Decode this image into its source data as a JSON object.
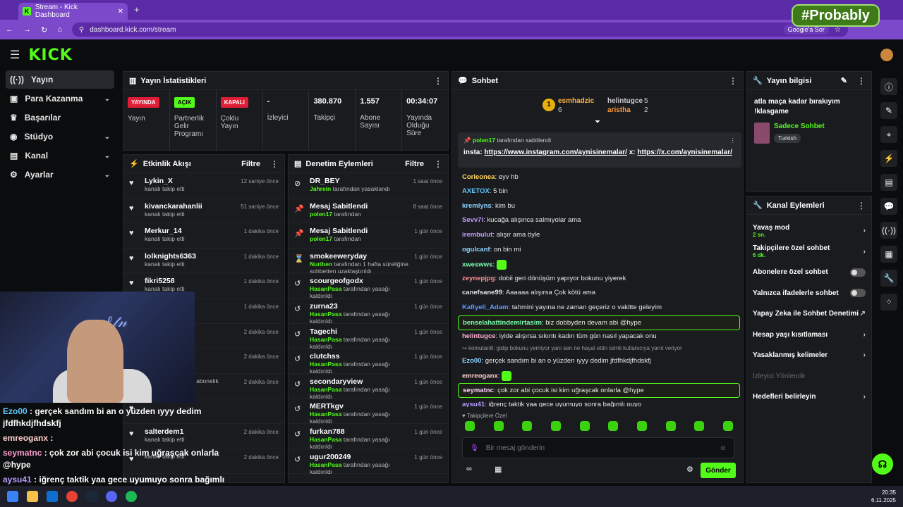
{
  "browser": {
    "tab_title": "Stream - Kick Dashboard",
    "url": "dashboard.kick.com/stream",
    "google_btn": "Google'a Sor",
    "overlay_badge": "#Probably"
  },
  "header": {
    "logo": "KICK"
  },
  "sidebar": {
    "items": [
      {
        "label": "Yayın",
        "icon": "stream-icon",
        "active": true
      },
      {
        "label": "Para Kazanma",
        "icon": "money-icon",
        "chevron": "⌄"
      },
      {
        "label": "Başarılar",
        "icon": "trophy-icon"
      },
      {
        "label": "Stüdyo",
        "icon": "studio-icon",
        "chevron": "⌄"
      },
      {
        "label": "Kanal",
        "icon": "channel-icon",
        "chevron": "⌄"
      },
      {
        "label": "Ayarlar",
        "icon": "settings-icon",
        "chevron": "⌄"
      }
    ]
  },
  "stats": {
    "title": "Yayın İstatistikleri",
    "cols": [
      {
        "badge": "YAYINDA",
        "badge_color": "#e01e37",
        "label": "Yayın"
      },
      {
        "badge": "AÇIK",
        "badge_color": "#53fc18",
        "label": "Partnerlik Gelir Programı"
      },
      {
        "badge": "KAPALI",
        "badge_color": "#e01e37",
        "label": "Çoklu Yayın"
      },
      {
        "value": "-",
        "label": "İzleyici"
      },
      {
        "value": "380.870",
        "label": "Takipçi"
      },
      {
        "value": "1.557",
        "label": "Abone Sayısı"
      },
      {
        "value": "00:34:07",
        "label": "Yayında Olduğu Süre"
      }
    ]
  },
  "events": {
    "title": "Etkinlik Akışı",
    "filter": "Filtre",
    "items": [
      {
        "name": "Lykin_X",
        "sub": "kanalı takip etti",
        "time": "12 saniye önce"
      },
      {
        "name": "kivanckarahanlii",
        "sub": "kanalı takip etti",
        "time": "51 saniye önce"
      },
      {
        "name": "Merkur_14",
        "sub": "kanalı takip etti",
        "time": "1 dakika önce"
      },
      {
        "name": "lolknights6363",
        "sub": "kanalı takip etti",
        "time": "1 dakika önce"
      },
      {
        "name": "fikri5258",
        "sub": "kanalı takip etti",
        "time": "1 dakika önce"
      },
      {
        "name": "",
        "sub": "",
        "time": "1 dakika önce"
      },
      {
        "name": "",
        "sub": "",
        "time": "2 dakika önce"
      },
      {
        "name": "",
        "sub": "",
        "time": "2 dakika önce"
      },
      {
        "name": "",
        "sub": "ni kutluyor! Toplam abonelik",
        "time": "2 dakika önce"
      },
      {
        "name": "",
        "sub": "",
        "time": ""
      },
      {
        "name": "salterdem1",
        "sub": "kanalı takip etti",
        "time": "2 dakika önce"
      },
      {
        "name": "",
        "sub": "kanalı takip etti",
        "time": "2 dakika önce"
      }
    ]
  },
  "mod": {
    "title": "Denetim Eylemleri",
    "filter": "Filtre",
    "items": [
      {
        "icon": "ban-icon",
        "glyph": "⊘",
        "name": "DR_BEY",
        "user": "Jahrein",
        "sub": "tarafından yasaklandı",
        "time": "1 saat önce"
      },
      {
        "icon": "pin-icon",
        "glyph": "📌",
        "name": "Mesaj Sabitlendi",
        "user": "polen17",
        "sub": "tarafından",
        "time": "8 saat önce"
      },
      {
        "icon": "pin-icon",
        "glyph": "📌",
        "name": "Mesaj Sabitlendi",
        "user": "polen17",
        "sub": "tarafından",
        "time": "1 gün önce"
      },
      {
        "icon": "hourglass-icon",
        "glyph": "⌛",
        "name": "smokeeweryday",
        "user": "Nuriben",
        "sub": "tarafından 1 hafta süreliğine sohbetten uzaklaştırıldı",
        "time": "1 gün önce"
      },
      {
        "icon": "undo-icon",
        "glyph": "↺",
        "name": "scourgeofgodx",
        "user": "HasanPasa",
        "sub": "tarafından yasağı kaldırıldı",
        "time": "1 gün önce"
      },
      {
        "icon": "undo-icon",
        "glyph": "↺",
        "name": "zurna23",
        "user": "HasanPasa",
        "sub": "tarafından yasağı kaldırıldı",
        "time": "1 gün önce"
      },
      {
        "icon": "undo-icon",
        "glyph": "↺",
        "name": "Tagechi",
        "user": "HasanPasa",
        "sub": "tarafından yasağı kaldırıldı",
        "time": "1 gün önce"
      },
      {
        "icon": "undo-icon",
        "glyph": "↺",
        "name": "clutchss",
        "user": "HasanPasa",
        "sub": "tarafından yasağı kaldırıldı",
        "time": "1 gün önce"
      },
      {
        "icon": "undo-icon",
        "glyph": "↺",
        "name": "secondaryview",
        "user": "HasanPasa",
        "sub": "tarafından yasağı kaldırıldı",
        "time": "1 gün önce"
      },
      {
        "icon": "undo-icon",
        "glyph": "↺",
        "name": "MERTkgv",
        "user": "HasanPasa",
        "sub": "tarafından yasağı kaldırıldı",
        "time": "1 gün önce"
      },
      {
        "icon": "undo-icon",
        "glyph": "↺",
        "name": "furkan788",
        "user": "HasanPasa",
        "sub": "tarafından yasağı kaldırıldı",
        "time": "1 gün önce"
      },
      {
        "icon": "undo-icon",
        "glyph": "↺",
        "name": "ugur200249",
        "user": "HasanPasa",
        "sub": "tarafından yasağı kaldırıldı",
        "time": "1 gün önce"
      }
    ]
  },
  "chat": {
    "title": "Sohbet",
    "gifters": [
      {
        "name": "esmhadzic",
        "count": "6"
      },
      {
        "name": "helintugce",
        "count": "5"
      },
      {
        "name": "aristha",
        "count": "2"
      }
    ],
    "pinned": {
      "by": "polen17",
      "by_suffix": "tarafından sabitlendi",
      "prefix": "insta:",
      "link1": "https://www.instagram.com/aynisinemalar/",
      "mid": "x:",
      "link2": "https://x.com/aynisinemalar/"
    },
    "messages": [
      {
        "user": "Corleonea",
        "color": "#ffd45e",
        "text": "eyv hb"
      },
      {
        "user": "AXETOX",
        "color": "#5ec8ff",
        "text": "5 bin"
      },
      {
        "user": "kremlyns",
        "color": "#8fd3ff",
        "text": "kim bu"
      },
      {
        "user": "Sevv7l",
        "color": "#c59cff",
        "text": "kucağa alışınca salmıyolar ama"
      },
      {
        "user": "irembulut",
        "color": "#c59cff",
        "text": "alışır ama öyle"
      },
      {
        "user": "ogulcanf",
        "color": "#8fd3ff",
        "text": "on bin mi"
      },
      {
        "user": "xweswws",
        "color": "#7cffb0",
        "text": ""
      },
      {
        "user": "zeynepjpg",
        "color": "#ff8e8e",
        "text": "dobii geri dönüşüm yapıyor bokunu yiyerek"
      },
      {
        "user": "canefsane99",
        "color": "#e6e6e6",
        "text": "Aaaaaa alışırsa Çok kötü ama"
      },
      {
        "user": "Kafiyeli_Adam",
        "color": "#5e9cff",
        "text": "tahmini yayına ne zaman geçeriz o vakitte geleyim"
      },
      {
        "user": "benselahattindemirtasim",
        "color": "#7cffb0",
        "text": "biz dobbyden devam abi @hype",
        "hl": true
      },
      {
        "user": "helintugce",
        "color": "#ffb0d0",
        "text": "iyide alışırsa sıkıntı kadın tüm gün nasıl yapacak onu"
      },
      {
        "user": "Ezo00",
        "color": "#8fd3ff",
        "text": "gerçek sandım bi an o yüzden ıyyy dedim jfdfhkdjfhdskfj"
      },
      {
        "user": "emreoganx",
        "color": "#ffd0d0",
        "text": ""
      },
      {
        "user": "seymatnc",
        "color": "#ffd0ff",
        "text": "çok zor abi çocuk isi kim uğraşcak onlarla @hype",
        "hl": true
      },
      {
        "user": "aysu41",
        "color": "#b49cff",
        "text": "iğrenç taktik yaa gece uyumuyo sonra bağımlı ouyo"
      }
    ],
    "reply_hint": "komutan8: gidip bokunu yemlyor yani sen ne hayal ettin",
    "reply_hint_suffix": "isimli kullanıcıya yanıt veriyor",
    "subs_label": "Takipçilere Özel",
    "input_placeholder": "Bir mesaj gönderin",
    "send_label": "Gönder"
  },
  "info": {
    "title": "Yayın bilgisi",
    "stream_title": "atla maça kadar bırakıyım !klasgame",
    "category": "Sadece Sohbet",
    "tag": "Turkish"
  },
  "actions": {
    "title": "Kanal Eylemleri",
    "items": [
      {
        "label": "Yavaş mod",
        "sub": "2 sn.",
        "type": "chevron"
      },
      {
        "label": "Takipçilere özel sohbet",
        "sub": "6 dk.",
        "type": "chevron"
      },
      {
        "label": "Abonelere özel sohbet",
        "type": "toggle"
      },
      {
        "label": "Yalnızca ifadelerle sohbet",
        "type": "toggle"
      },
      {
        "label": "Yapay Zeka ile Sohbet Denetimi",
        "type": "external"
      },
      {
        "label": "Hesap yaşı kısıtlaması",
        "type": "chevron"
      },
      {
        "label": "Yasaklanmış kelimeler",
        "type": "chevron"
      },
      {
        "label": "İzleyici Yönlendir",
        "type": "disabled"
      },
      {
        "label": "Hedefleri belirleyin",
        "type": "chevron"
      }
    ]
  },
  "overlay_chat": [
    {
      "user": "Ezo00",
      "cls": "u1",
      "text": ": gerçek sandım bi an o yüzden ıyyy dedim jfdfhkdjfhdskfj"
    },
    {
      "user": "emreoganx",
      "cls": "u3",
      "text": ":"
    },
    {
      "user": "seymatnc",
      "cls": "u2",
      "text": ": çok zor abi çocuk isi kim uğraşcak onlarla @hype"
    },
    {
      "user": "aysu41",
      "cls": "u4",
      "text": ": iğrenç taktik yaa gece uyumuyo sonra bağımlı ouyo"
    }
  ],
  "taskbar": {
    "time": "20:35",
    "date": "6.11.2025"
  }
}
